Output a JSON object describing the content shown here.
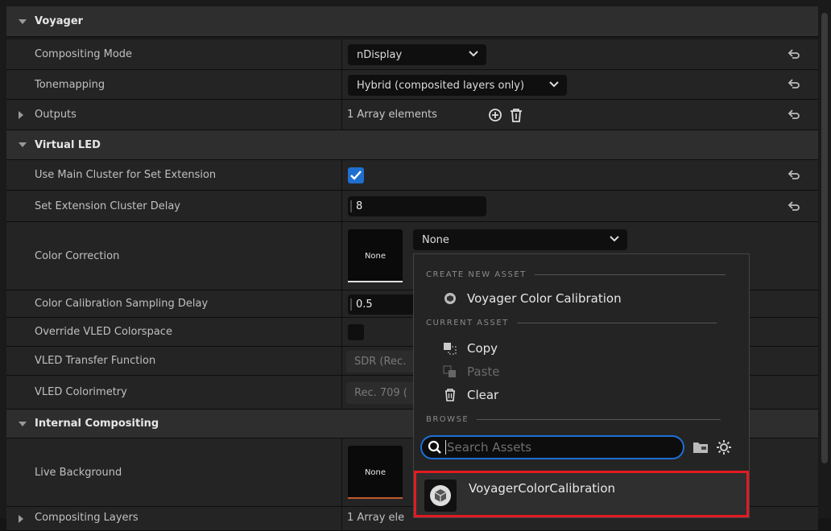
{
  "categories": {
    "voyager": "Voyager",
    "virtual_led": "Virtual LED",
    "internal_compositing": "Internal Compositing"
  },
  "properties": {
    "compositing_mode": {
      "label": "Compositing Mode",
      "value": "nDisplay"
    },
    "tonemapping": {
      "label": "Tonemapping",
      "value": "Hybrid (composited layers only)"
    },
    "outputs": {
      "label": "Outputs",
      "value": "1 Array elements"
    },
    "use_main_cluster": {
      "label": "Use Main Cluster for Set Extension",
      "checked": true
    },
    "set_ext_delay": {
      "label": "Set Extension Cluster Delay",
      "value": "8"
    },
    "color_correction": {
      "label": "Color Correction",
      "thumb": "None",
      "value": "None"
    },
    "cal_sampling_delay": {
      "label": "Color Calibration Sampling Delay",
      "value": "0.5"
    },
    "override_vled": {
      "label": "Override VLED Colorspace",
      "checked": false
    },
    "vled_transfer": {
      "label": "VLED Transfer Function",
      "value": "SDR (Rec."
    },
    "vled_colorimetry": {
      "label": "VLED Colorimetry",
      "value": "Rec. 709 ("
    },
    "live_background": {
      "label": "Live Background",
      "thumb": "None"
    },
    "compositing_layers": {
      "label": "Compositing Layers",
      "value": "1 Array ele"
    }
  },
  "popup": {
    "create_header": "CREATE NEW ASSET",
    "create_item": "Voyager Color Calibration",
    "current_header": "CURRENT ASSET",
    "copy": "Copy",
    "paste": "Paste",
    "clear": "Clear",
    "browse_header": "BROWSE",
    "search_placeholder": "Search Assets",
    "result": "VoyagerColorCalibration"
  },
  "colors": {
    "accent": "#1e6fd6",
    "highlight": "#e21a22"
  }
}
